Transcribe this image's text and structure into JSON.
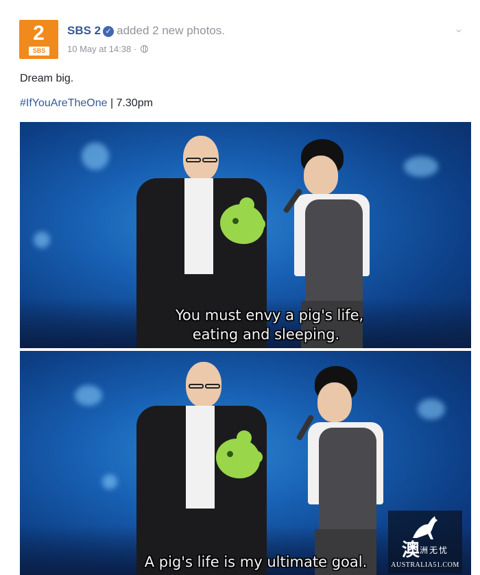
{
  "post": {
    "page_name": "SBS 2",
    "action_text": "added 2 new photos.",
    "timestamp": "10 May at 14:38",
    "meta_separator": "·",
    "caption": "Dream big.",
    "hashtag": "#IfYouAreTheOne",
    "hashtag_separator": "|",
    "air_time": "7.30pm",
    "avatar": {
      "number": "2",
      "brand": "SBS"
    }
  },
  "photos": [
    {
      "subtitle_line1": "You must envy a pig's life,",
      "subtitle_line2": "eating and sleeping."
    },
    {
      "subtitle_line1": "A pig's life is my ultimate goal."
    }
  ],
  "watermark": {
    "char_big": "澳",
    "char_small": "洲无忧",
    "site": "AUSTRALIA51.COM"
  },
  "icons": {
    "verified": "verified-badge-icon",
    "globe": "globe-icon",
    "chevron": "chevron-down-icon",
    "watermark": "kangaroo-icon"
  },
  "colors": {
    "link": "#365899",
    "meta": "#90949c",
    "avatar": "#f08a1c",
    "stage_blue": "#1860b3"
  }
}
